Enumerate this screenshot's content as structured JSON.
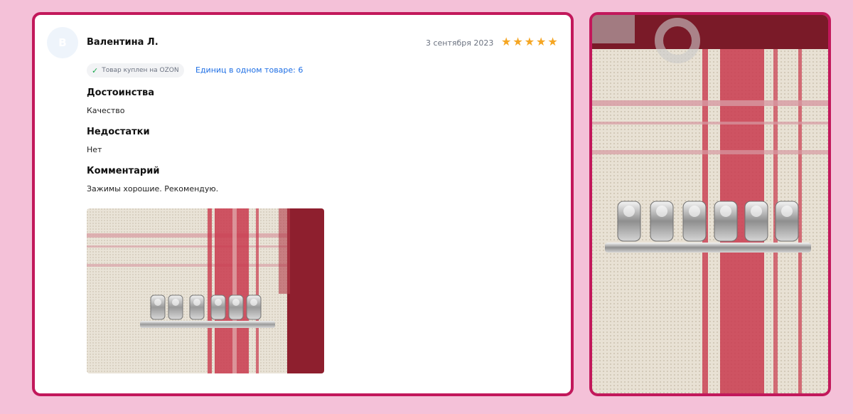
{
  "review": {
    "avatar_letter": "В",
    "author": "Валентина Л.",
    "date": "3 сентября 2023",
    "rating": 5,
    "verified_badge": "Товар куплен на OZON",
    "units_label": "Единиц в одном товаре: 6",
    "sections": [
      {
        "title": "Достоинства",
        "text": "Качество"
      },
      {
        "title": "Недостатки",
        "text": "Нет"
      },
      {
        "title": "Комментарий",
        "text": "Зажимы хорошие. Рекомендую."
      }
    ],
    "photo_icon": "review-photo-binder-clips"
  },
  "colors": {
    "background": "#f4c1d8",
    "frame": "#c2185b",
    "star": "#f5a623",
    "link": "#1f6fe5",
    "check": "#18a84b"
  }
}
